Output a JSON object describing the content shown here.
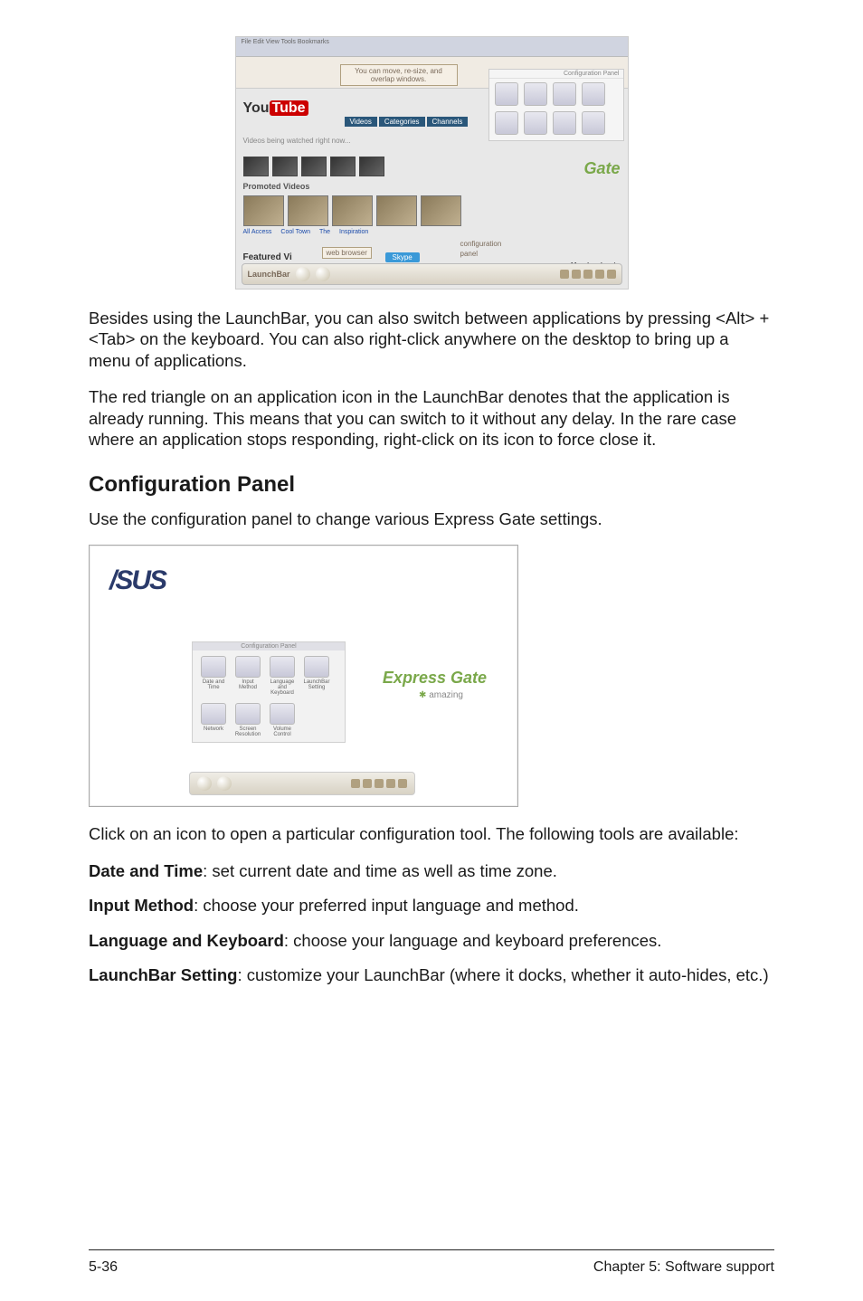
{
  "figure1": {
    "callout_top": "You can move, re-size, and overlap windows.",
    "youtube_you": "You",
    "youtube_tube": "Tube",
    "tabs": [
      "Videos",
      "Categories",
      "Channels"
    ],
    "subtext": "Videos being watched right now...",
    "promoted": "Promoted Videos",
    "bluelinks": [
      "All Access",
      "Cool Town",
      "The",
      "Inspiration"
    ],
    "featured": "Featured Vi",
    "bg_callout": "web browser",
    "skype": "Skype",
    "lbcallout": "LaunchBar",
    "cfg_hdr": "Configuration Panel",
    "gate": "Gate",
    "conf_left": "configuration",
    "conf_right": "panel",
    "member": "Member Login",
    "launchbar_text": "LaunchBar"
  },
  "para1": "Besides using the LaunchBar, you can also switch between applications by pressing <Alt> +<Tab> on the keyboard. You can also right-click anywhere on the desktop to bring up a menu of applications.",
  "para2": "The red triangle on an application icon in the LaunchBar denotes that the application is already running. This means that you can switch to it without any delay. In the rare case where an application stops responding, right-click on its icon to force close it.",
  "heading": "Configuration Panel",
  "para3": "Use the configuration panel to change various Express Gate settings.",
  "figure2": {
    "asus": "/SUS",
    "panel_hdr": "Configuration Panel",
    "icons": [
      "Date and Time",
      "Input Method",
      "Language and Keyboard",
      "LaunchBar Setting",
      "Network",
      "Screen Resolution",
      "Volume Control"
    ],
    "eg": "Express Gate",
    "eg_tag": "amazing"
  },
  "para4": "Click on an icon to open a particular configuration tool. The following tools are available:",
  "tools": [
    {
      "name": "Date and Time",
      "desc": ": set current date and time as well as time zone."
    },
    {
      "name": "Input Method",
      "desc": ": choose your preferred input language and method."
    },
    {
      "name": "Language and Keyboard",
      "desc": ": choose your language and keyboard preferences."
    },
    {
      "name": "LaunchBar Setting",
      "desc": ": customize your LaunchBar (where it docks, whether it auto-hides, etc.)"
    }
  ],
  "footer": {
    "left": "5-36",
    "right": "Chapter 5: Software support"
  }
}
